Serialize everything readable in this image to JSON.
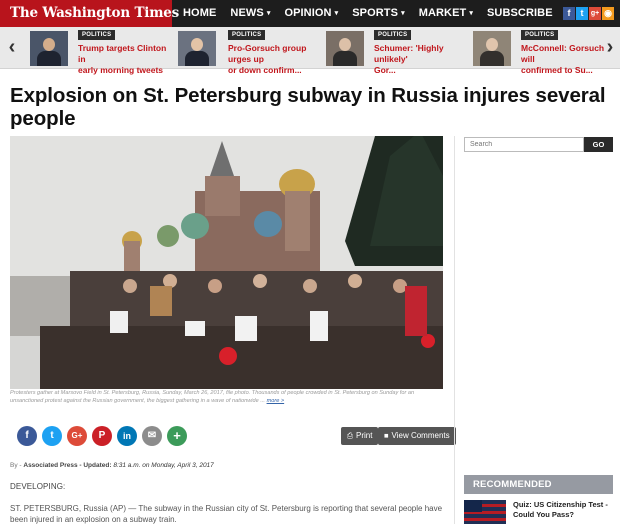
{
  "site": {
    "logo_text": "The Washington Times"
  },
  "nav": {
    "items": [
      {
        "label": "HOME",
        "has_dropdown": false
      },
      {
        "label": "NEWS",
        "has_dropdown": true
      },
      {
        "label": "OPINION",
        "has_dropdown": true
      },
      {
        "label": "SPORTS",
        "has_dropdown": true
      },
      {
        "label": "MARKET",
        "has_dropdown": true
      },
      {
        "label": "SUBSCRIBE",
        "has_dropdown": false
      }
    ],
    "caret": "▾",
    "social": [
      {
        "icon": "facebook-icon",
        "glyph": "f",
        "color": "#3b5998"
      },
      {
        "icon": "twitter-icon",
        "glyph": "t",
        "color": "#1da1f2"
      },
      {
        "icon": "google-plus-icon",
        "glyph": "g+",
        "color": "#dd4b39"
      },
      {
        "icon": "rss-icon",
        "glyph": "◉",
        "color": "#f39a1e"
      }
    ]
  },
  "headline_strip": {
    "prev_arrow": "‹",
    "next_arrow": "›",
    "items": [
      {
        "badge": "POLITICS",
        "title_line1": "Trump targets Clinton in",
        "title_line2": "early morning tweets"
      },
      {
        "badge": "POLITICS",
        "title_line1": "Pro-Gorsuch group urges up",
        "title_line2": "or down confirm..."
      },
      {
        "badge": "POLITICS",
        "title_line1": "Schumer: 'Highly unlikely'",
        "title_line2": "Gor..."
      },
      {
        "badge": "POLITICS",
        "title_line1": "McConnell: Gorsuch will",
        "title_line2": "confirmed to Su..."
      }
    ]
  },
  "article": {
    "headline": "Explosion on St. Petersburg subway in Russia injures several people",
    "caption": "Protesters gather at Marsovo Field in St. Petersburg, Russia, Sunday, March 26, 2017, file photo. Thousands of people crowded in St. Petersburg on Sunday for an unsanctioned protest against the Russian government, the biggest gathering in a wave of nationwide ...",
    "caption_more": "more >",
    "share_icons": [
      {
        "icon": "facebook-share-icon",
        "glyph": "f",
        "color": "#3b5998"
      },
      {
        "icon": "twitter-share-icon",
        "glyph": "t",
        "color": "#1da1f2"
      },
      {
        "icon": "google-plus-share-icon",
        "glyph": "G+",
        "color": "#dd4b39"
      },
      {
        "icon": "pinterest-share-icon",
        "glyph": "P",
        "color": "#cb2027"
      },
      {
        "icon": "linkedin-share-icon",
        "glyph": "in",
        "color": "#0077b5"
      },
      {
        "icon": "email-share-icon",
        "glyph": "✉",
        "color": "#8c8c8c"
      },
      {
        "icon": "more-share-icon",
        "glyph": "+",
        "color": "#3c9b5a"
      }
    ],
    "print_label": "Print",
    "print_icon": "⎙",
    "comments_label": "View Comments",
    "comments_icon": "■",
    "byline_prefix": "By -",
    "byline_author": "Associated Press",
    "byline_sep": "- Updated:",
    "byline_date": "8:31 a.m. on Monday, April 3, 2017",
    "developing": "DEVELOPING:",
    "body": "ST. PETERSBURG, Russia (AP) — The subway in the Russian city of St. Petersburg is reporting that several people have been injured in an explosion on a subway train."
  },
  "sidebar": {
    "search_placeholder": "Search",
    "search_button": "GO",
    "recommended_header": "RECOMMENDED",
    "recommended": [
      {
        "title": "Quiz: US Citizenship Test - Could You Pass?"
      }
    ]
  }
}
